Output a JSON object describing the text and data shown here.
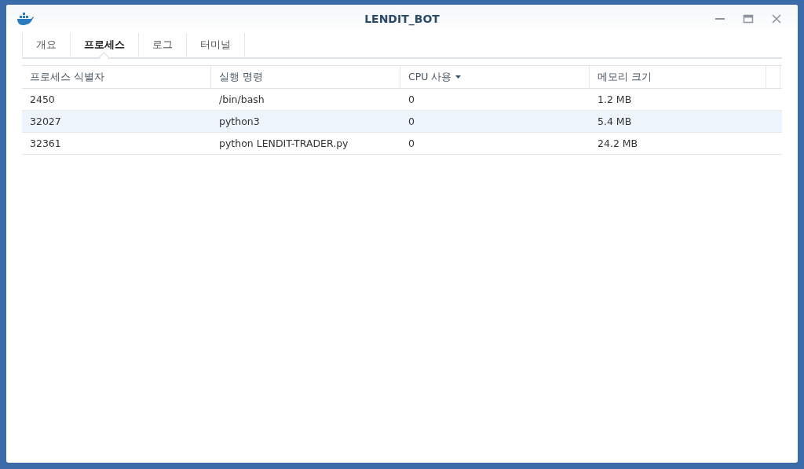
{
  "window": {
    "title": "LENDIT_BOT"
  },
  "tabs": [
    {
      "label": "개요",
      "selected": false
    },
    {
      "label": "프로세스",
      "selected": true
    },
    {
      "label": "로그",
      "selected": false
    },
    {
      "label": "터미널",
      "selected": false
    }
  ],
  "table": {
    "columns": [
      {
        "label": "프로세스 식별자",
        "sorted": false
      },
      {
        "label": "실행 명령",
        "sorted": false
      },
      {
        "label": "CPU 사용",
        "sorted": true
      },
      {
        "label": "메모리 크기",
        "sorted": false
      }
    ],
    "rows": [
      {
        "cells": [
          "2450",
          "/bin/bash",
          "0",
          "1.2 MB"
        ],
        "selected": false
      },
      {
        "cells": [
          "32027",
          "python3",
          "0",
          "5.4 MB"
        ],
        "selected": true
      },
      {
        "cells": [
          "32361",
          "python LENDIT-TRADER.py",
          "0",
          "24.2 MB"
        ],
        "selected": false
      }
    ]
  }
}
